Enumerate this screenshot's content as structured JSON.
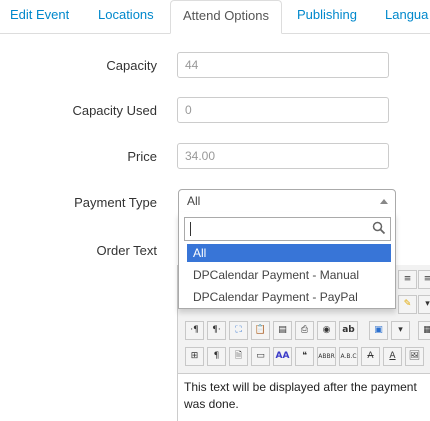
{
  "tabs": [
    {
      "label": "Edit Event"
    },
    {
      "label": "Locations"
    },
    {
      "label": "Attend Options"
    },
    {
      "label": "Publishing"
    },
    {
      "label": "Langua"
    }
  ],
  "form": {
    "capacity": {
      "label": "Capacity",
      "value": "44"
    },
    "capacity_used": {
      "label": "Capacity Used",
      "value": "0"
    },
    "price": {
      "label": "Price",
      "value": "34.00"
    },
    "payment_type": {
      "label": "Payment Type",
      "selected": "All",
      "search_value": "",
      "options": [
        "All",
        "DPCalendar Payment - Manual",
        "DPCalendar Payment - PayPal"
      ]
    },
    "order_text": {
      "label": "Order Text",
      "content": "This text will be displayed after the payment was done."
    }
  },
  "colors": {
    "link": "#0088cc",
    "highlight": "#3875d7"
  }
}
